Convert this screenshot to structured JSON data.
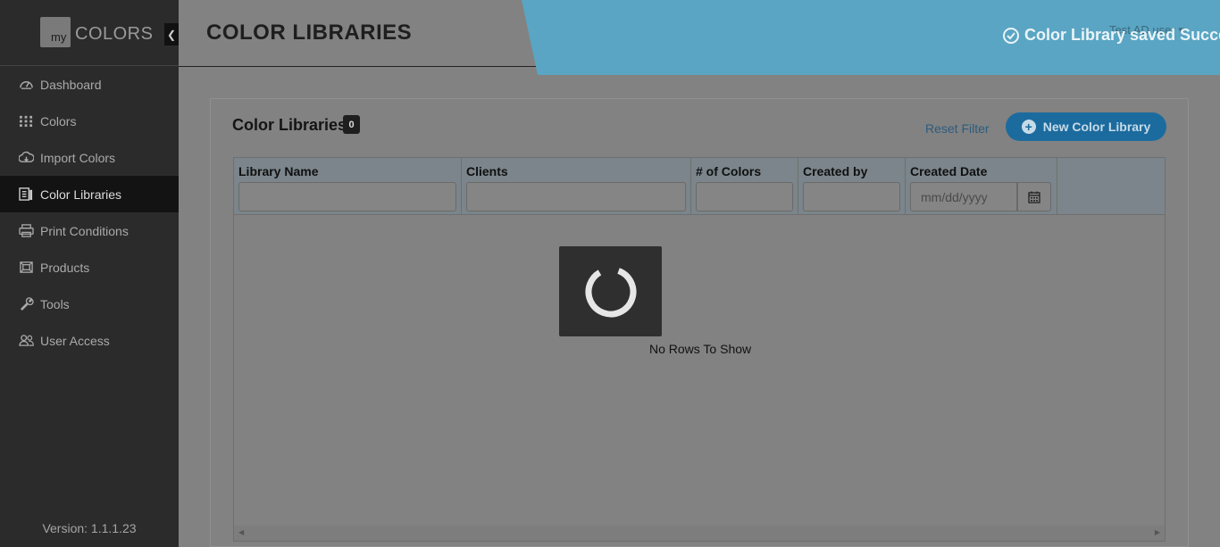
{
  "app": {
    "logo_my": "my",
    "logo_colors": "COLORS",
    "version": "Version: 1.1.1.23"
  },
  "sidebar": {
    "items": [
      {
        "label": "Dashboard",
        "icon": "dashboard-icon"
      },
      {
        "label": "Colors",
        "icon": "grid-dots-icon"
      },
      {
        "label": "Import Colors",
        "icon": "cloud-upload-icon"
      },
      {
        "label": "Color Libraries",
        "icon": "library-icon",
        "active": true
      },
      {
        "label": "Print Conditions",
        "icon": "printer-icon"
      },
      {
        "label": "Products",
        "icon": "product-icon"
      },
      {
        "label": "Tools",
        "icon": "wrench-icon"
      },
      {
        "label": "User Access",
        "icon": "users-icon"
      }
    ]
  },
  "header": {
    "title": "COLOR LIBRARIES",
    "user": "Test AD user",
    "toast": "Color Library saved Succe"
  },
  "card": {
    "title": "Color Libraries",
    "count": "0",
    "reset_filter": "Reset Filter",
    "new_button": "New Color Library"
  },
  "grid": {
    "columns": [
      "Library Name",
      "Clients",
      "# of Colors",
      "Created by",
      "Created Date"
    ],
    "date_placeholder": "mm/dd/yyyy",
    "empty_text": "No Rows To Show"
  },
  "colors": {
    "sidebar_bg": "#2b2b2b",
    "toast_bg": "#5aa5c3",
    "accent_button": "#1c6b9e",
    "overlay": "#828282"
  }
}
